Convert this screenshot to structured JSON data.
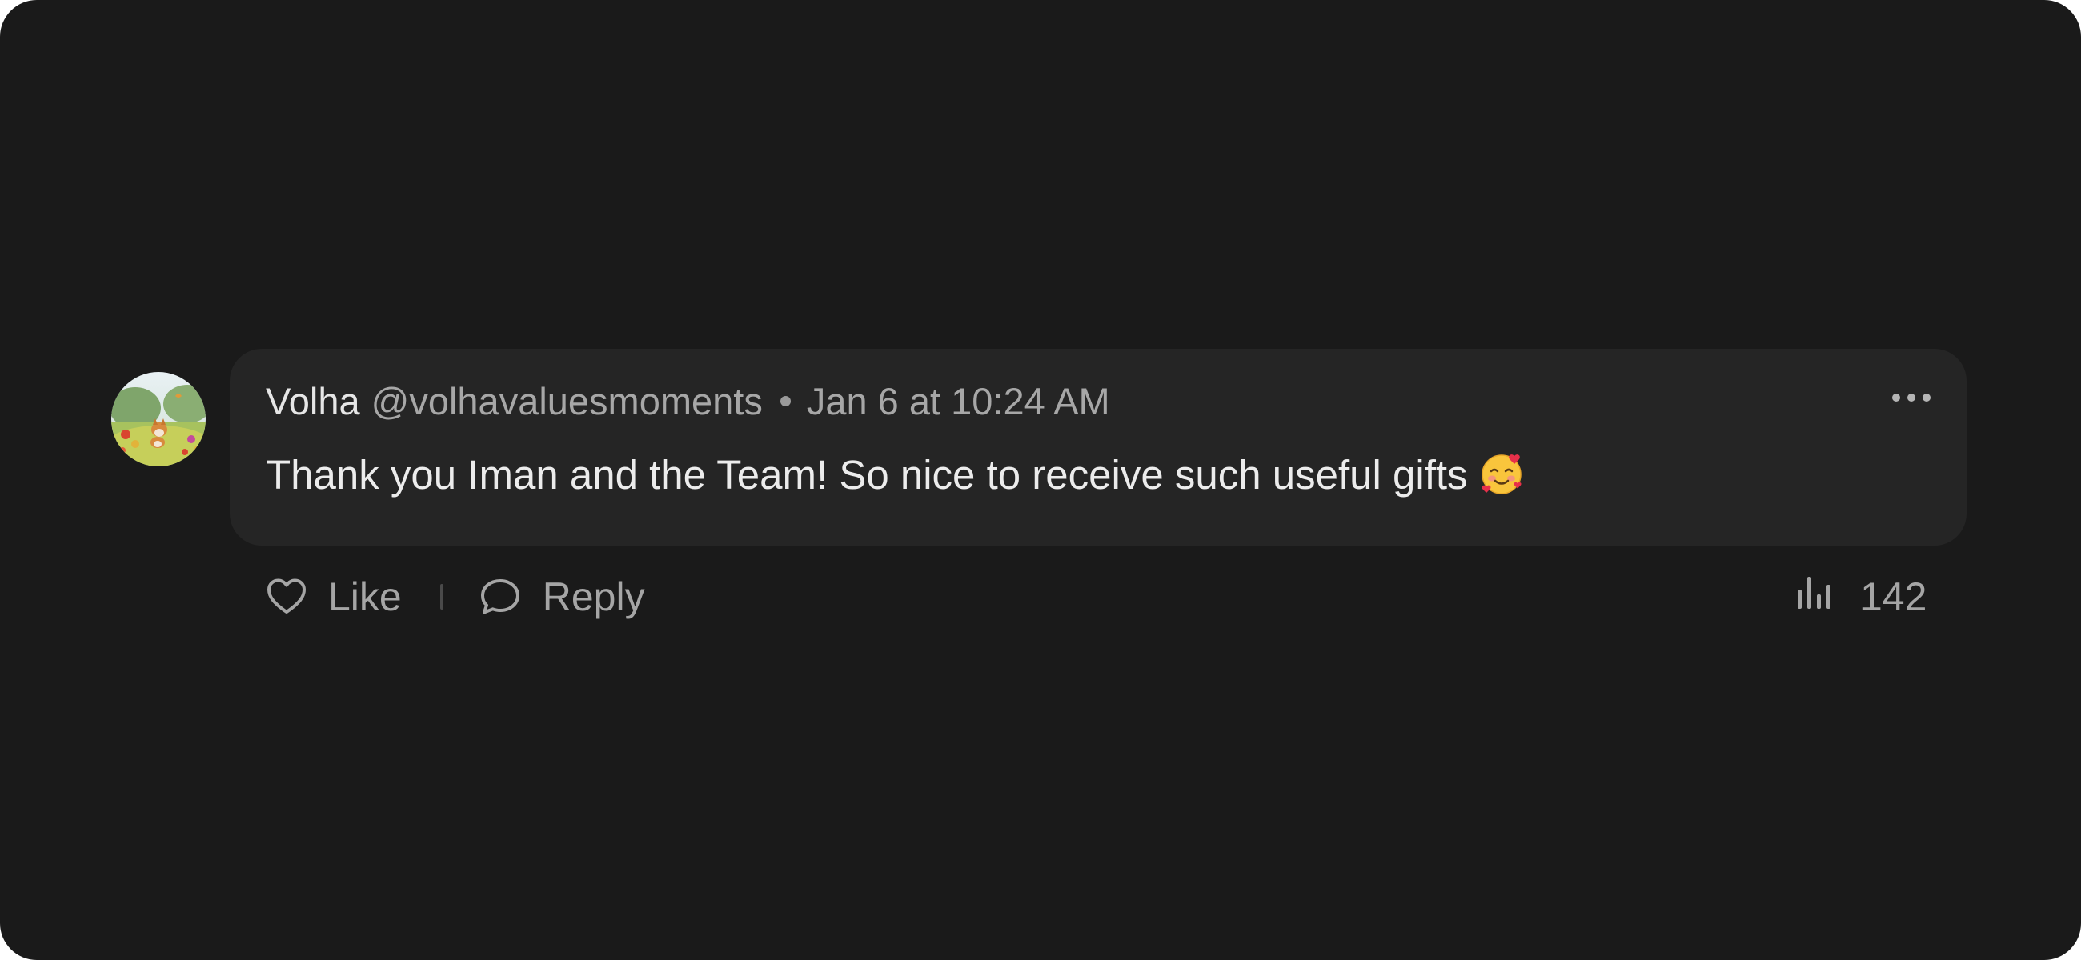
{
  "comment": {
    "author": "Volha",
    "handle": "@volhavaluesmoments",
    "timestamp": "Jan 6 at 10:24 AM",
    "message": "Thank you Iman and the Team! So nice to receive such useful gifts",
    "emoji": "smiling-face-with-hearts"
  },
  "actions": {
    "like_label": "Like",
    "reply_label": "Reply",
    "views_count": "142"
  },
  "icons": {
    "like": "heart-icon",
    "reply": "speech-bubble-icon",
    "views": "bar-chart-icon",
    "more": "ellipsis-icon"
  },
  "colors": {
    "background": "#1a1a1a",
    "bubble": "#252525",
    "author_text": "#e6e6e6",
    "secondary_text": "#a7a7a7",
    "message_text": "#ececec"
  }
}
